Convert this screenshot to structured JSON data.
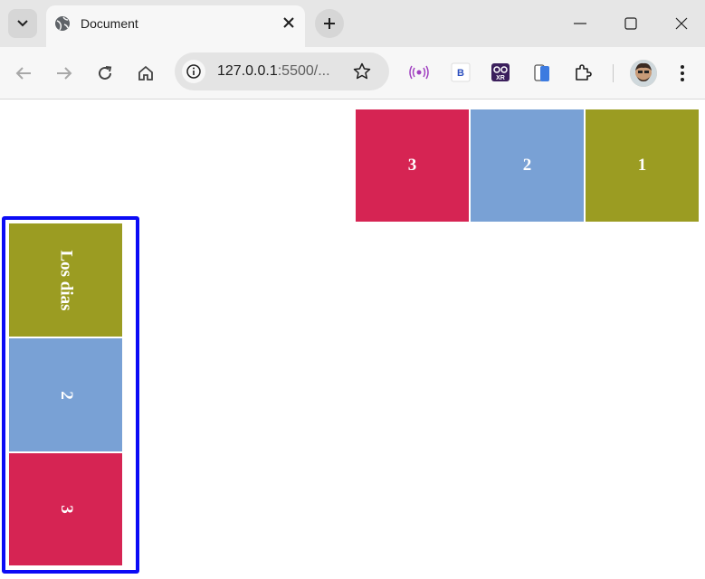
{
  "browser": {
    "tab": {
      "title": "Document"
    },
    "address": {
      "host": "127.0.0.1",
      "rest": ":5500/..."
    }
  },
  "page": {
    "horizontal_row": [
      {
        "label": "3",
        "color": "#d62453"
      },
      {
        "label": "2",
        "color": "#79a1d5"
      },
      {
        "label": "1",
        "color": "#9b9c22"
      }
    ],
    "vertical_column": [
      {
        "label": "Los dias",
        "color": "#9b9c22"
      },
      {
        "label": "2",
        "color": "#79a1d5"
      },
      {
        "label": "3",
        "color": "#d62453"
      }
    ],
    "vertical_border_color": "#0b0bf5"
  }
}
